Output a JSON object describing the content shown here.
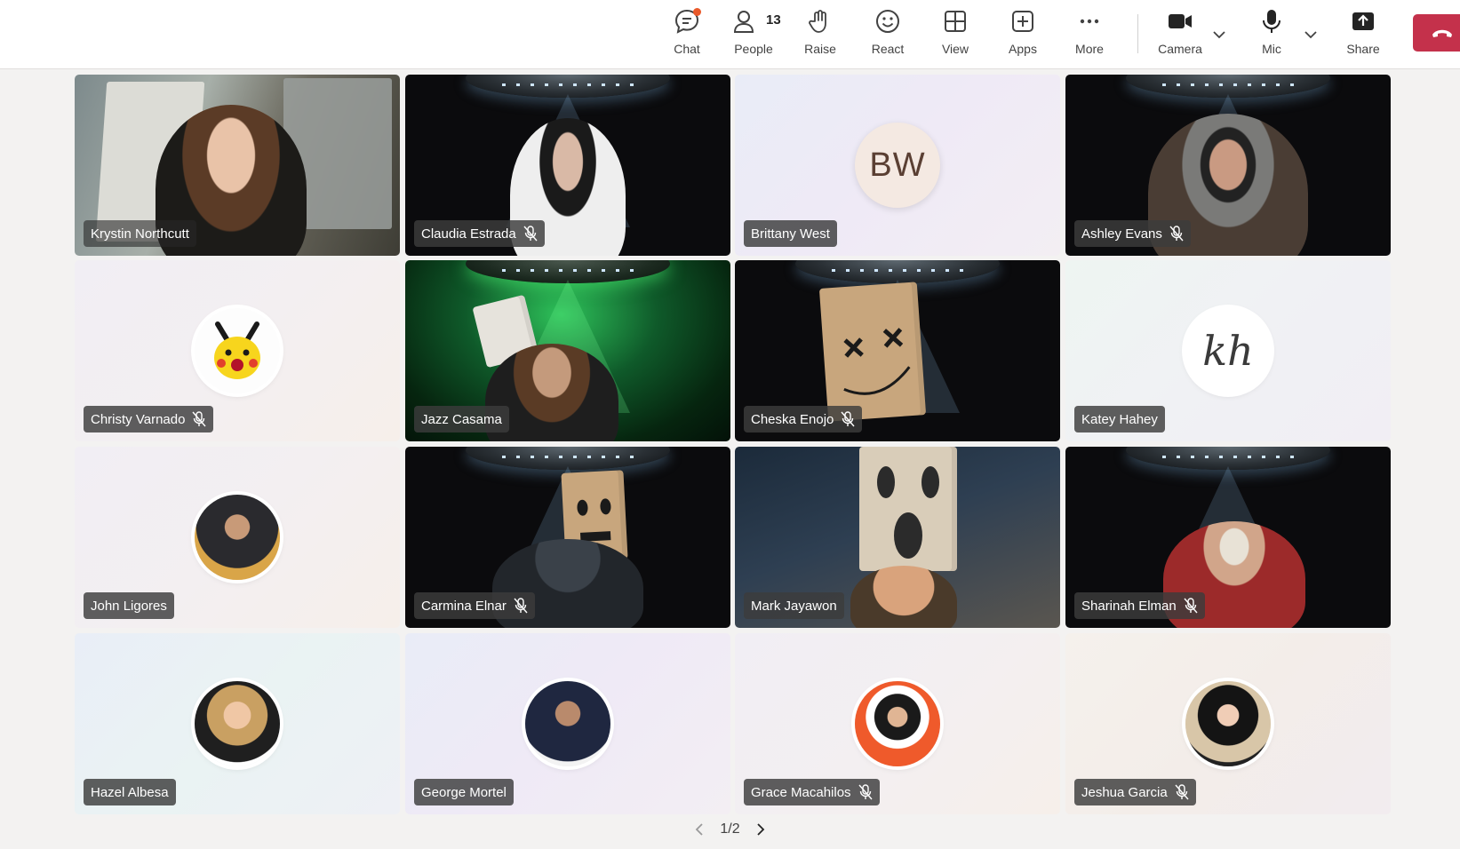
{
  "toolbar": {
    "chat_label": "Chat",
    "people_label": "People",
    "people_count": "13",
    "raise_label": "Raise",
    "react_label": "React",
    "view_label": "View",
    "apps_label": "Apps",
    "more_label": "More",
    "camera_label": "Camera",
    "mic_label": "Mic",
    "share_label": "Share",
    "leave_color": "#c4314b",
    "notification_color": "#e9592a"
  },
  "participants": [
    {
      "name": "Krystin Northcutt",
      "muted": false,
      "tile": "video"
    },
    {
      "name": "Claudia Estrada",
      "muted": true,
      "tile": "video"
    },
    {
      "name": "Brittany West",
      "muted": false,
      "tile": "initials",
      "initials": "BW"
    },
    {
      "name": "Ashley Evans",
      "muted": true,
      "tile": "video"
    },
    {
      "name": "Christy Varnado",
      "muted": true,
      "tile": "avatar",
      "avatar_icon": "pikachu-avatar-icon"
    },
    {
      "name": "Jazz Casama",
      "muted": false,
      "tile": "video"
    },
    {
      "name": "Cheska Enojo",
      "muted": true,
      "tile": "video"
    },
    {
      "name": "Katey Hahey",
      "muted": false,
      "tile": "avatar",
      "avatar_text": "kh"
    },
    {
      "name": "John Ligores",
      "muted": false,
      "tile": "avatar",
      "avatar_icon": "photo-avatar-icon"
    },
    {
      "name": "Carmina Elnar",
      "muted": true,
      "tile": "video"
    },
    {
      "name": "Mark Jayawon",
      "muted": false,
      "tile": "video"
    },
    {
      "name": "Sharinah Elman",
      "muted": true,
      "tile": "video"
    },
    {
      "name": "Hazel Albesa",
      "muted": false,
      "tile": "avatar",
      "avatar_icon": "photo-avatar-icon"
    },
    {
      "name": "George Mortel",
      "muted": false,
      "tile": "avatar",
      "avatar_icon": "photo-avatar-icon"
    },
    {
      "name": "Grace Macahilos",
      "muted": true,
      "tile": "avatar",
      "avatar_icon": "photo-avatar-icon"
    },
    {
      "name": "Jeshua Garcia",
      "muted": true,
      "tile": "avatar",
      "avatar_icon": "photo-avatar-icon"
    }
  ],
  "pager": {
    "label": "1/2"
  }
}
